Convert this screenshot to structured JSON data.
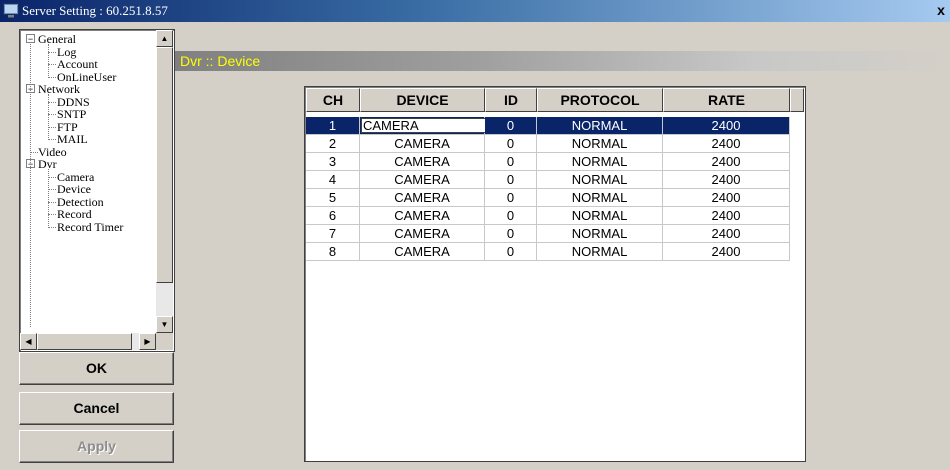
{
  "window": {
    "title": "Server Setting : 60.251.8.57",
    "close_label": "x"
  },
  "tree": {
    "groups": [
      {
        "label": "General",
        "expander": "−",
        "children": [
          "Log",
          "Account",
          "OnLineUser"
        ]
      },
      {
        "label": "Network",
        "expander": "−",
        "children": [
          "DDNS",
          "SNTP",
          "FTP",
          "MAIL"
        ]
      },
      {
        "label": "Video",
        "expander": "",
        "children": []
      },
      {
        "label": "Dvr",
        "expander": "−",
        "children": [
          "Camera",
          "Device",
          "Detection",
          "Record",
          "Record Timer"
        ]
      }
    ]
  },
  "buttons": {
    "ok": "OK",
    "cancel": "Cancel",
    "apply": "Apply"
  },
  "section": {
    "title": "Dvr :: Device"
  },
  "table": {
    "columns": [
      "CH",
      "DEVICE",
      "ID",
      "PROTOCOL",
      "RATE"
    ],
    "rows": [
      [
        "1",
        "CAMERA",
        "0",
        "NORMAL",
        "2400"
      ],
      [
        "2",
        "CAMERA",
        "0",
        "NORMAL",
        "2400"
      ],
      [
        "3",
        "CAMERA",
        "0",
        "NORMAL",
        "2400"
      ],
      [
        "4",
        "CAMERA",
        "0",
        "NORMAL",
        "2400"
      ],
      [
        "5",
        "CAMERA",
        "0",
        "NORMAL",
        "2400"
      ],
      [
        "6",
        "CAMERA",
        "0",
        "NORMAL",
        "2400"
      ],
      [
        "7",
        "CAMERA",
        "0",
        "NORMAL",
        "2400"
      ],
      [
        "8",
        "CAMERA",
        "0",
        "NORMAL",
        "2400"
      ]
    ],
    "selected_row": 0
  },
  "colors": {
    "title_bar": "#0a246a",
    "selection": "#0a246a",
    "section_title": "#ffff00",
    "face": "#d4d0c8"
  },
  "icons": {
    "app": "monitor-icon",
    "scroll_up": "arrow-up-icon",
    "scroll_down": "arrow-down-icon",
    "scroll_left": "arrow-left-icon",
    "scroll_right": "arrow-right-icon",
    "combo": "chevron-down-icon"
  }
}
